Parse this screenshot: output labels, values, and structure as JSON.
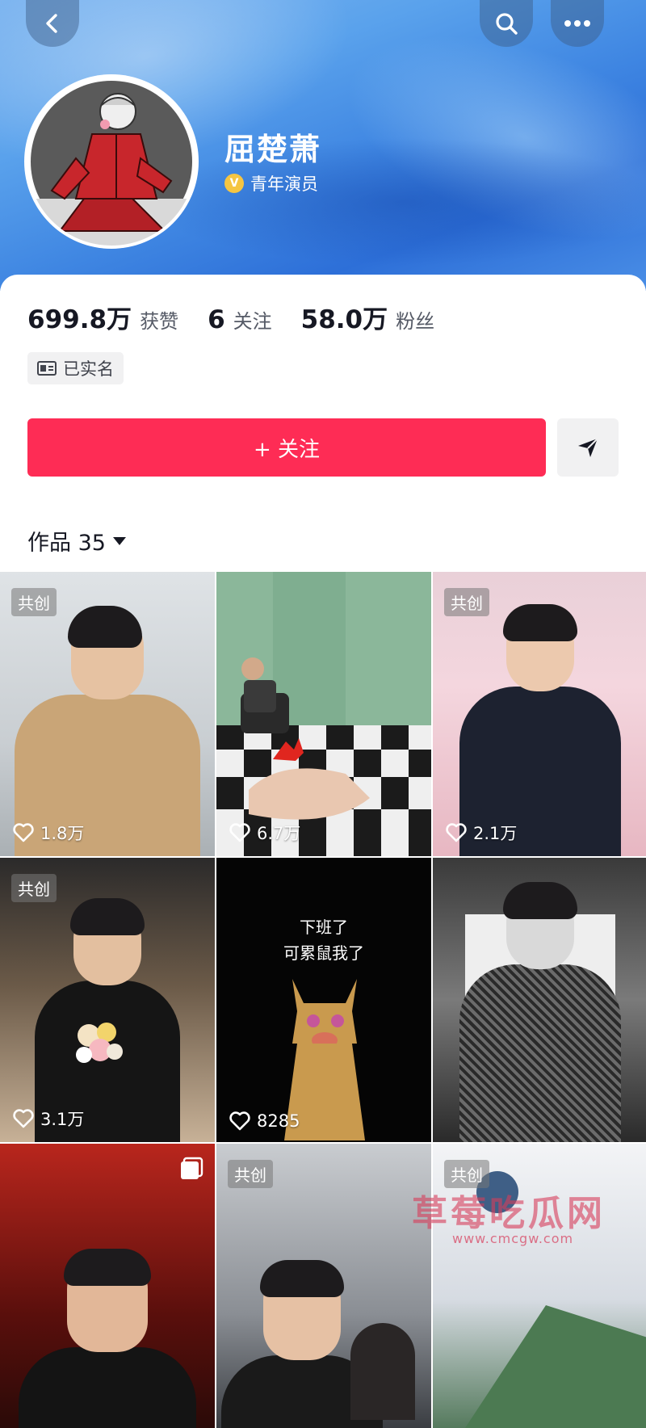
{
  "header": {
    "name": "屈楚萧",
    "verify_badge": "V",
    "title": "青年演员"
  },
  "stats": {
    "likes_value": "699.8万",
    "likes_label": "获赞",
    "following_value": "6",
    "following_label": "关注",
    "fans_value": "58.0万",
    "fans_label": "粉丝"
  },
  "realname": {
    "label": "已实名",
    "icon": "id-card-icon"
  },
  "actions": {
    "follow_label": "+ 关注",
    "share_icon": "send-icon"
  },
  "tabs": {
    "works_label": "作品 35"
  },
  "grid": {
    "tiles": [
      {
        "badge": "共创",
        "likes": "1.8万"
      },
      {
        "badge": "",
        "likes": "6.7万"
      },
      {
        "badge": "共创",
        "likes": "2.1万"
      },
      {
        "badge": "共创",
        "likes": "3.1万"
      },
      {
        "badge": "",
        "likes": "8285",
        "caption_line1": "下班了",
        "caption_line2": "可累鼠我了"
      },
      {
        "badge": "",
        "likes": ""
      },
      {
        "badge": "",
        "likes": ""
      },
      {
        "badge": "共创",
        "likes": ""
      },
      {
        "badge": "共创",
        "likes": ""
      }
    ]
  },
  "watermark": {
    "title": "草莓吃瓜网",
    "url": "www.cmcgw.com"
  },
  "colors": {
    "accent": "#fe2c55",
    "header_blue": "#3f86e2"
  }
}
